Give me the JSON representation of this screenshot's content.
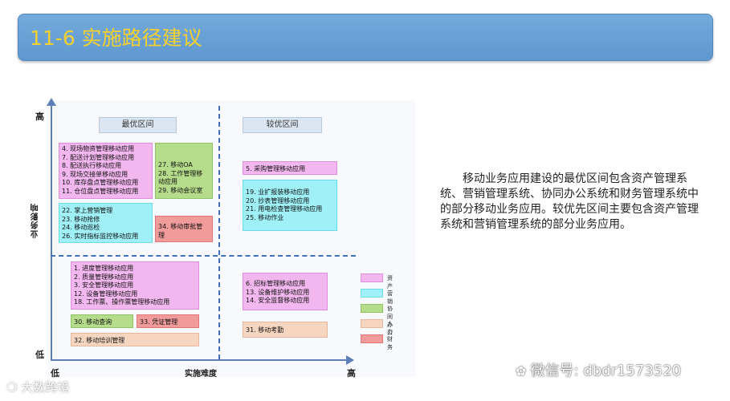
{
  "header": {
    "title": "11-6 实施路径建议"
  },
  "diagram": {
    "y_axis": {
      "label": "业务影响",
      "high": "高",
      "low": "低"
    },
    "x_axis": {
      "label": "实施难度",
      "low": "低",
      "high": "高"
    },
    "zones": {
      "best": "最优区间",
      "better": "较优区间"
    },
    "q1_assets": [
      "4. 现场物资管理移动应用",
      "7. 配送计划管理移动应用",
      "8. 配送执行移动应用",
      "9. 现场交接单移动应用",
      "10. 库存盘点管理移动应用",
      "11. 仓位盘点管理移动应用"
    ],
    "q1_collab": [
      "27. 移动OA",
      "28. 工作管理移",
      "动应用",
      "29. 移动会议室"
    ],
    "q1_sales": [
      "22. 掌上营销管理",
      "23. 移动抢修",
      "24. 移动巡检",
      "26. 实时指标监控移动应用"
    ],
    "q1_finance": [
      "34. 移动审批管",
      "理"
    ],
    "q2_assets": [
      "5. 采购管理移动应用"
    ],
    "q2_sales": [
      "19. 业扩报装移动应用",
      "20. 抄表管理移动应用",
      "21. 用电检查管理移动应用",
      "25. 移动作业"
    ],
    "q3_assets": [
      "1. 进度管理移动应用",
      "2. 质量管理移动应用",
      "3. 安全管理移动应用",
      "12. 设备管理移动应用",
      "18. 工作票、操作票管理移动应用"
    ],
    "q3_collab": [
      "30. 移动查询"
    ],
    "q3_finance": [
      "33. 凭证管理"
    ],
    "q3_hr": [
      "32. 移动培训管理"
    ],
    "q4_assets": [
      "6. 招标管理移动应用",
      "13. 设备维护移动应用",
      "14. 安全监督移动应用"
    ],
    "q4_hr": [
      "31. 移动考勤"
    ],
    "legend": [
      {
        "label": "资产",
        "color": "#f2b7ee"
      },
      {
        "label": "营销",
        "color": "#9ff1f7"
      },
      {
        "label": "协同办公",
        "color": "#b5dc8b"
      },
      {
        "label": "人力",
        "color": "#f6d6c0"
      },
      {
        "label": "财务",
        "color": "#f19b9b"
      }
    ]
  },
  "description": "移动业务应用建设的最优区间包含资产管理系统、营销管理系统、协同办公系统和财务管理系统中的部分移动业务应用。较优先区间主要包含资产管理系统和营销管理系统的部分业务应用。",
  "watermarks": {
    "wechat": "微信号: dbdr1573520",
    "brand": "大数跨境"
  }
}
